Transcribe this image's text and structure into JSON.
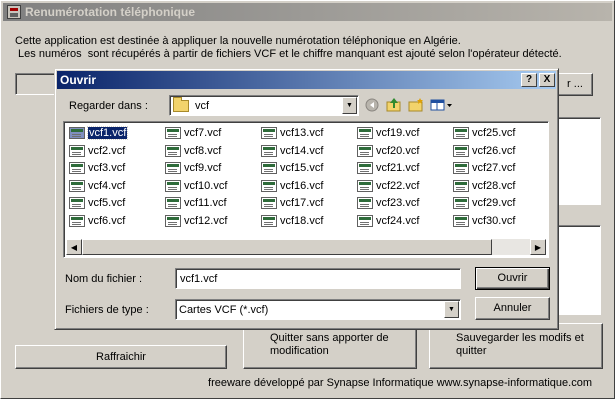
{
  "main_window": {
    "title": "Renumérotation téléphonique",
    "intro_line1": "Cette application est destinée à appliquer la nouvelle numérotation téléphonique en Algérie.",
    "intro_line2": " Les numéros  sont récupérés à partir de fichiers VCF et le chiffre manquant est ajouté selon l'opérateur détecté.",
    "browse_button_label": "r ...",
    "refresh_button_label": "Raffraichir",
    "quit_button_label": "Quitter sans apporter de modification",
    "save_quit_button_label": "Sauvegarder les modifs et quitter",
    "footer": "freeware développé par Synapse Informatique www.synapse-informatique.com"
  },
  "open_dialog": {
    "title": "Ouvrir",
    "help_button": "?",
    "close_button": "X",
    "look_in_label": "Regarder dans :",
    "look_in_value": "vcf",
    "toolbar_icons": [
      "back-icon",
      "up-folder-icon",
      "new-folder-icon",
      "view-menu-icon"
    ],
    "files": [
      [
        "vcf1.vcf",
        "vcf7.vcf",
        "vcf13.vcf",
        "vcf19.vcf",
        "vcf25.vcf"
      ],
      [
        "vcf2.vcf",
        "vcf8.vcf",
        "vcf14.vcf",
        "vcf20.vcf",
        "vcf26.vcf"
      ],
      [
        "vcf3.vcf",
        "vcf9.vcf",
        "vcf15.vcf",
        "vcf21.vcf",
        "vcf27.vcf"
      ],
      [
        "vcf4.vcf",
        "vcf10.vcf",
        "vcf16.vcf",
        "vcf22.vcf",
        "vcf28.vcf"
      ],
      [
        "vcf5.vcf",
        "vcf11.vcf",
        "vcf17.vcf",
        "vcf23.vcf",
        "vcf29.vcf"
      ],
      [
        "vcf6.vcf",
        "vcf12.vcf",
        "vcf18.vcf",
        "vcf24.vcf",
        "vcf30.vcf"
      ]
    ],
    "selected_file": "vcf1.vcf",
    "filename_label": "Nom du fichier :",
    "filename_value": "vcf1.vcf",
    "filetype_label": "Fichiers de type :",
    "filetype_value": "Cartes VCF (*.vcf)",
    "open_button": "Ouvrir",
    "cancel_button": "Annuler"
  },
  "colors": {
    "dialog_title_start": "#0a246a",
    "dialog_title_end": "#a6caf0",
    "inactive_title_start": "#808080",
    "face": "#d4d0c8"
  }
}
